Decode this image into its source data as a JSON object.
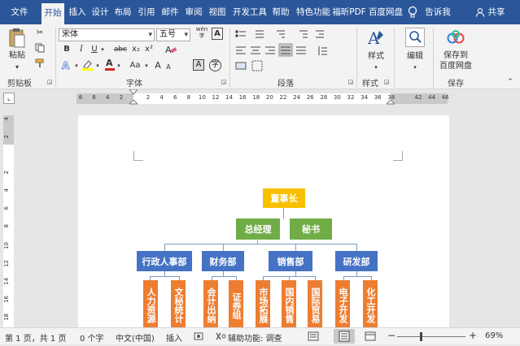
{
  "tabs": {
    "file": "文件",
    "home": "开始",
    "insert": "插入",
    "design": "设计",
    "layout": "布局",
    "references": "引用",
    "mailings": "邮件",
    "review": "审阅",
    "view": "视图",
    "developer": "开发工具",
    "help": "帮助",
    "special": "特色功能",
    "foxit_pdf": "福昕PDF",
    "baidu_netdisk": "百度网盘",
    "tell_me": "告诉我",
    "share": "共享"
  },
  "ribbon": {
    "paste": "粘贴",
    "clipboard_label": "剪贴板",
    "font_name": "宋体",
    "font_size": "五号",
    "font_label": "字体",
    "paragraph_label": "段落",
    "styles": "样式",
    "styles_label": "样式",
    "editing": "编辑",
    "save_to": "保存到",
    "baidu_disk": "百度网盘",
    "save_label": "保存",
    "wen": "wén",
    "bold": "B",
    "italic": "I",
    "underline": "U",
    "strike": "abc",
    "sub": "x₂",
    "sup": "x²",
    "font_color_a": "A",
    "aa": "Aa",
    "enlarge": "A",
    "shrink": "A",
    "char_border": "A",
    "phonetic": "字"
  },
  "ruler": {
    "h_ticks": [
      "8",
      "6",
      "4",
      "2",
      "",
      "2",
      "4",
      "6",
      "8",
      "10",
      "12",
      "14",
      "16",
      "18",
      "20",
      "22",
      "24",
      "26",
      "28",
      "30",
      "32",
      "34",
      "36",
      "38",
      "",
      "42",
      "44",
      "46"
    ],
    "v_ticks": [
      "4",
      "2",
      "",
      "2",
      "4",
      "6",
      "8",
      "10",
      "12",
      "14",
      "16",
      "18"
    ]
  },
  "org": {
    "chairman": "董事长",
    "gm": "总经理",
    "secretary": "秘书",
    "departments": [
      "行政人事部",
      "财务部",
      "销售部",
      "研发部"
    ],
    "sub_units": [
      "人力资源",
      "文秘统计",
      "会计出纳",
      "证券组",
      "市场拓展",
      "国内销售",
      "国际贸易",
      "电子开发",
      "化工开发"
    ]
  },
  "status": {
    "page": "第 1 页，共 1 页",
    "words": "0 个字",
    "language": "中文(中国)",
    "mode": "插入",
    "accessibility": "辅助功能: 调查",
    "zoom": "69%"
  },
  "colors": {
    "accent": "#2b579a",
    "gold": "#f8c000",
    "green": "#70ad47",
    "blue": "#4472c4",
    "orange": "#ed7d31"
  }
}
